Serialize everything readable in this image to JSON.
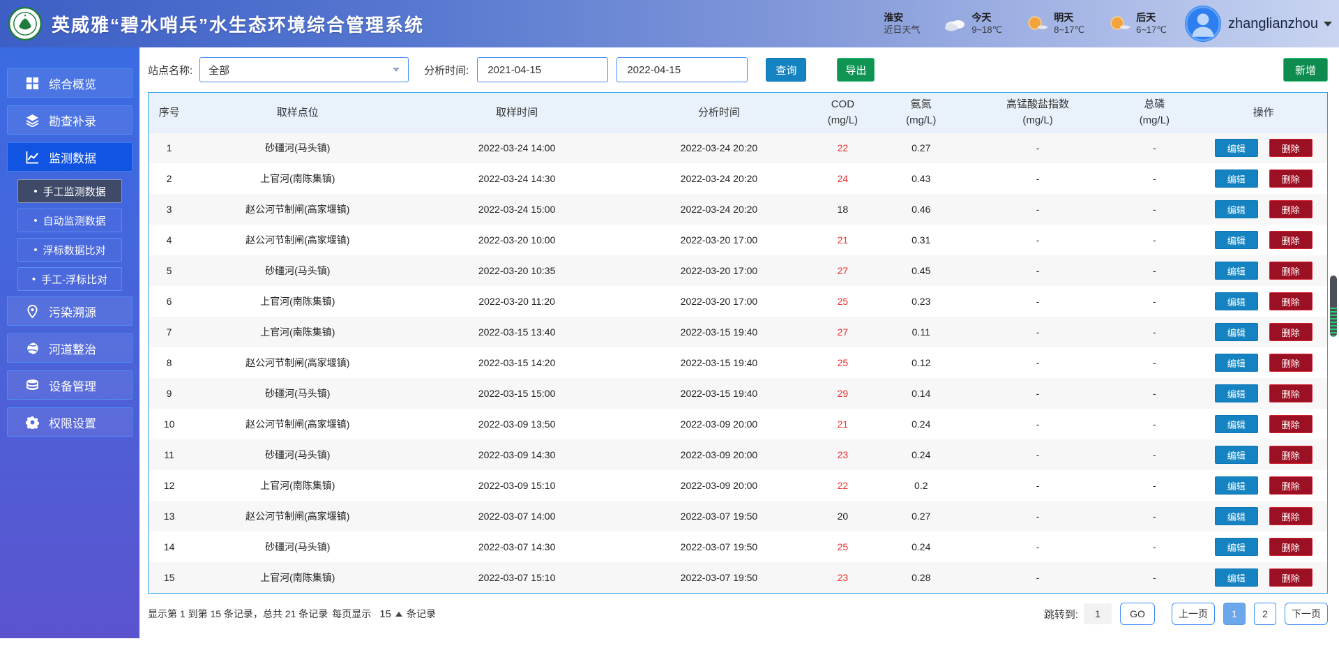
{
  "header": {
    "title": "英威雅“碧水哨兵”水生态环境综合管理系统",
    "weather": {
      "city": "淮安",
      "city_sub": "近日天气",
      "days": [
        {
          "label": "今天",
          "temp": "9~18℃",
          "icon": "cloudy-icon"
        },
        {
          "label": "明天",
          "temp": "8~17℃",
          "icon": "sunny-icon"
        },
        {
          "label": "后天",
          "temp": "6~17℃",
          "icon": "sunny-icon"
        }
      ]
    },
    "user": {
      "name": "zhanglianzhou"
    }
  },
  "sidebar": {
    "items": [
      {
        "label": "综合概览",
        "icon": "grid-icon",
        "active": false
      },
      {
        "label": "勘查补录",
        "icon": "layers-icon",
        "active": false
      },
      {
        "label": "监测数据",
        "icon": "chart-icon",
        "active": true,
        "children": [
          {
            "label": "手工监测数据",
            "active": true
          },
          {
            "label": "自动监测数据",
            "active": false
          },
          {
            "label": "浮标数据比对",
            "active": false
          },
          {
            "label": "手工-浮标比对",
            "active": false
          }
        ]
      },
      {
        "label": "污染溯源",
        "icon": "pin-icon",
        "active": false
      },
      {
        "label": "河道整治",
        "icon": "globe-icon",
        "active": false
      },
      {
        "label": "设备管理",
        "icon": "database-icon",
        "active": false
      },
      {
        "label": "权限设置",
        "icon": "gear-icon",
        "active": false
      }
    ]
  },
  "filters": {
    "station_label": "站点名称:",
    "station_value": "全部",
    "time_label": "分析时间:",
    "date_from": "2021-04-15",
    "date_to": "2022-04-15",
    "search_btn": "查询",
    "export_btn": "导出",
    "add_btn": "新增"
  },
  "table": {
    "columns": [
      {
        "line1": "序号",
        "line2": ""
      },
      {
        "line1": "取样点位",
        "line2": ""
      },
      {
        "line1": "取样时间",
        "line2": ""
      },
      {
        "line1": "分析时间",
        "line2": ""
      },
      {
        "line1": "COD",
        "line2": "(mg/L)"
      },
      {
        "line1": "氨氮",
        "line2": "(mg/L)"
      },
      {
        "line1": "高锰酸盐指数",
        "line2": "(mg/L)"
      },
      {
        "line1": "总磷",
        "line2": "(mg/L)"
      },
      {
        "line1": "操作",
        "line2": ""
      }
    ],
    "edit_label": "编辑",
    "delete_label": "删除",
    "rows": [
      {
        "no": "1",
        "site": "砂礓河(马头镇)",
        "sample_time": "2022-03-24 14:00",
        "analysis_time": "2022-03-24 20:20",
        "cod": "22",
        "cod_red": true,
        "nh3n": "0.27",
        "kmno4": "-",
        "tp": "-"
      },
      {
        "no": "2",
        "site": "上官河(南陈集镇)",
        "sample_time": "2022-03-24 14:30",
        "analysis_time": "2022-03-24 20:20",
        "cod": "24",
        "cod_red": true,
        "nh3n": "0.43",
        "kmno4": "-",
        "tp": "-"
      },
      {
        "no": "3",
        "site": "赵公河节制闸(高家堰镇)",
        "sample_time": "2022-03-24 15:00",
        "analysis_time": "2022-03-24 20:20",
        "cod": "18",
        "cod_red": false,
        "nh3n": "0.46",
        "kmno4": "-",
        "tp": "-"
      },
      {
        "no": "4",
        "site": "赵公河节制闸(高家堰镇)",
        "sample_time": "2022-03-20 10:00",
        "analysis_time": "2022-03-20 17:00",
        "cod": "21",
        "cod_red": true,
        "nh3n": "0.31",
        "kmno4": "-",
        "tp": "-"
      },
      {
        "no": "5",
        "site": "砂礓河(马头镇)",
        "sample_time": "2022-03-20 10:35",
        "analysis_time": "2022-03-20 17:00",
        "cod": "27",
        "cod_red": true,
        "nh3n": "0.45",
        "kmno4": "-",
        "tp": "-"
      },
      {
        "no": "6",
        "site": "上官河(南陈集镇)",
        "sample_time": "2022-03-20 11:20",
        "analysis_time": "2022-03-20 17:00",
        "cod": "25",
        "cod_red": true,
        "nh3n": "0.23",
        "kmno4": "-",
        "tp": "-"
      },
      {
        "no": "7",
        "site": "上官河(南陈集镇)",
        "sample_time": "2022-03-15 13:40",
        "analysis_time": "2022-03-15 19:40",
        "cod": "27",
        "cod_red": true,
        "nh3n": "0.11",
        "kmno4": "-",
        "tp": "-"
      },
      {
        "no": "8",
        "site": "赵公河节制闸(高家堰镇)",
        "sample_time": "2022-03-15 14:20",
        "analysis_time": "2022-03-15 19:40",
        "cod": "25",
        "cod_red": true,
        "nh3n": "0.12",
        "kmno4": "-",
        "tp": "-"
      },
      {
        "no": "9",
        "site": "砂礓河(马头镇)",
        "sample_time": "2022-03-15 15:00",
        "analysis_time": "2022-03-15 19:40",
        "cod": "29",
        "cod_red": true,
        "nh3n": "0.14",
        "kmno4": "-",
        "tp": "-"
      },
      {
        "no": "10",
        "site": "赵公河节制闸(高家堰镇)",
        "sample_time": "2022-03-09 13:50",
        "analysis_time": "2022-03-09 20:00",
        "cod": "21",
        "cod_red": true,
        "nh3n": "0.24",
        "kmno4": "-",
        "tp": "-"
      },
      {
        "no": "11",
        "site": "砂礓河(马头镇)",
        "sample_time": "2022-03-09 14:30",
        "analysis_time": "2022-03-09 20:00",
        "cod": "23",
        "cod_red": true,
        "nh3n": "0.24",
        "kmno4": "-",
        "tp": "-"
      },
      {
        "no": "12",
        "site": "上官河(南陈集镇)",
        "sample_time": "2022-03-09 15:10",
        "analysis_time": "2022-03-09 20:00",
        "cod": "22",
        "cod_red": true,
        "nh3n": "0.2",
        "kmno4": "-",
        "tp": "-"
      },
      {
        "no": "13",
        "site": "赵公河节制闸(高家堰镇)",
        "sample_time": "2022-03-07 14:00",
        "analysis_time": "2022-03-07 19:50",
        "cod": "20",
        "cod_red": false,
        "nh3n": "0.27",
        "kmno4": "-",
        "tp": "-"
      },
      {
        "no": "14",
        "site": "砂礓河(马头镇)",
        "sample_time": "2022-03-07 14:30",
        "analysis_time": "2022-03-07 19:50",
        "cod": "25",
        "cod_red": true,
        "nh3n": "0.24",
        "kmno4": "-",
        "tp": "-"
      },
      {
        "no": "15",
        "site": "上官河(南陈集镇)",
        "sample_time": "2022-03-07 15:10",
        "analysis_time": "2022-03-07 19:50",
        "cod": "23",
        "cod_red": true,
        "nh3n": "0.28",
        "kmno4": "-",
        "tp": "-"
      }
    ]
  },
  "footer": {
    "summary": "显示第 1 到第 15 条记录，总共 21 条记录",
    "per_page_prefix": "每页显示",
    "per_page": "15",
    "per_page_suffix": "条记录",
    "jump_label": "跳转到:",
    "jump_value": "1",
    "go": "GO",
    "prev": "上一页",
    "pages": [
      "1",
      "2"
    ],
    "active_page": "1",
    "next": "下一页"
  }
}
